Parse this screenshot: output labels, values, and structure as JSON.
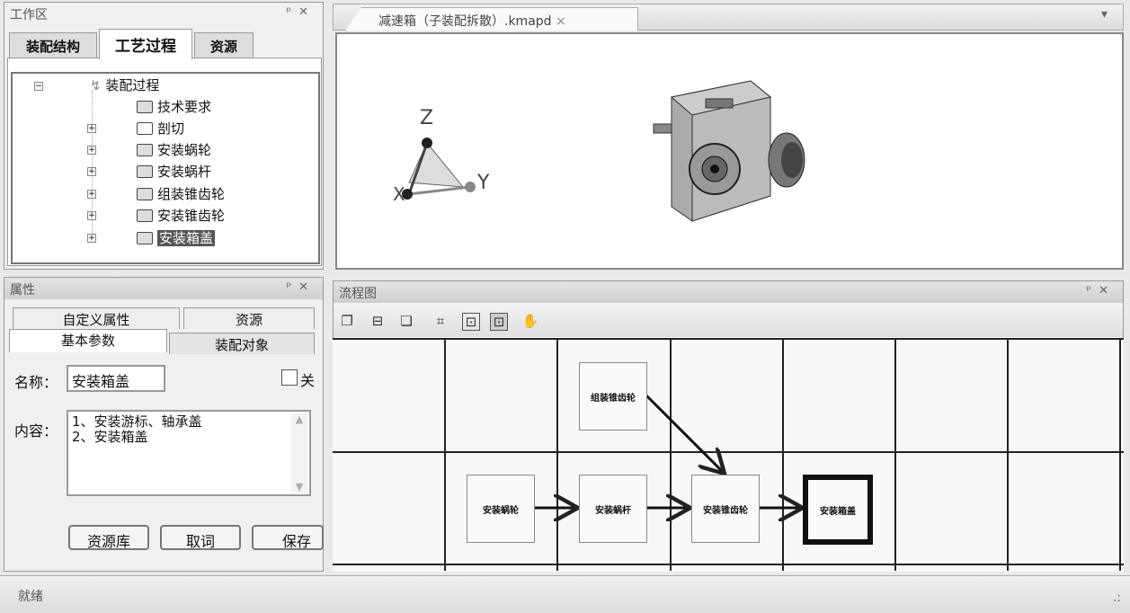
{
  "workspace": {
    "title": "工作区",
    "pin": "ᵖ",
    "close": "✕",
    "tabs": [
      "装配结构",
      "工艺过程",
      "资源"
    ],
    "active_tab": 1,
    "tree": {
      "root": "装配过程",
      "children": [
        "技术要求",
        "剖切",
        "安装蜗轮",
        "安装蜗杆",
        "组装锥齿轮",
        "安装锥齿轮",
        "安装箱盖"
      ],
      "selected": "安装箱盖"
    }
  },
  "document": {
    "tab_label": "减速箱（子装配拆散）.kmapd",
    "tab_close": "×",
    "dropdown": "▾",
    "axes": {
      "z": "Z",
      "y": "Y",
      "x": "X"
    }
  },
  "properties": {
    "title": "属性",
    "tabs_back": [
      "自定义属性",
      "资源"
    ],
    "tabs_front": [
      "基本参数",
      "装配对象"
    ],
    "active_tab": "基本参数",
    "name_label": "名称：",
    "name_value": "安装箱盖",
    "checkbox_label": "关",
    "content_label": "内容：",
    "content_value": "1、安装游标、轴承盖\n2、安装箱盖",
    "buttons": [
      "资源库",
      "取词",
      "保存"
    ]
  },
  "flowchart": {
    "title": "流程图",
    "nodes": [
      "组装锥齿轮",
      "安装蜗轮",
      "安装蜗杆",
      "安装锥齿轮",
      "安装箱盖"
    ],
    "selected": "安装箱盖",
    "toolbar": [
      "copy-icon",
      "insert-icon",
      "paste-icon",
      "fit-icon",
      "zoom-window-icon",
      "zoom-icon",
      "pan-hand-icon"
    ]
  },
  "status": {
    "text": "就绪",
    "grip": ".:"
  }
}
